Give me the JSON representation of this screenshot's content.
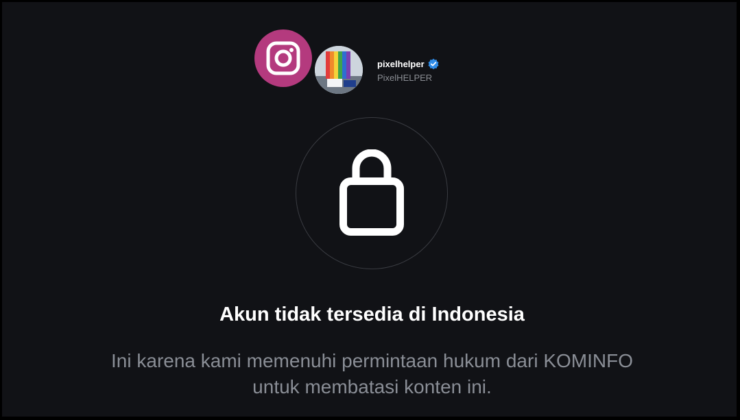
{
  "profile": {
    "username": "pixelhelper",
    "display_name": "PixelHELPER",
    "verified": true
  },
  "notice": {
    "title": "Akun tidak tersedia di Indonesia",
    "line1": "Ini karena kami memenuhi permintaan hukum dari KOMINFO",
    "line2": "untuk membatasi konten ini."
  },
  "icons": {
    "app_badge": "instagram-icon",
    "lock": "lock-icon",
    "verified": "verified-badge-icon"
  },
  "colors": {
    "background": "#111216",
    "instagram_badge": "#b43a7e",
    "verified": "#2f8ce8"
  }
}
